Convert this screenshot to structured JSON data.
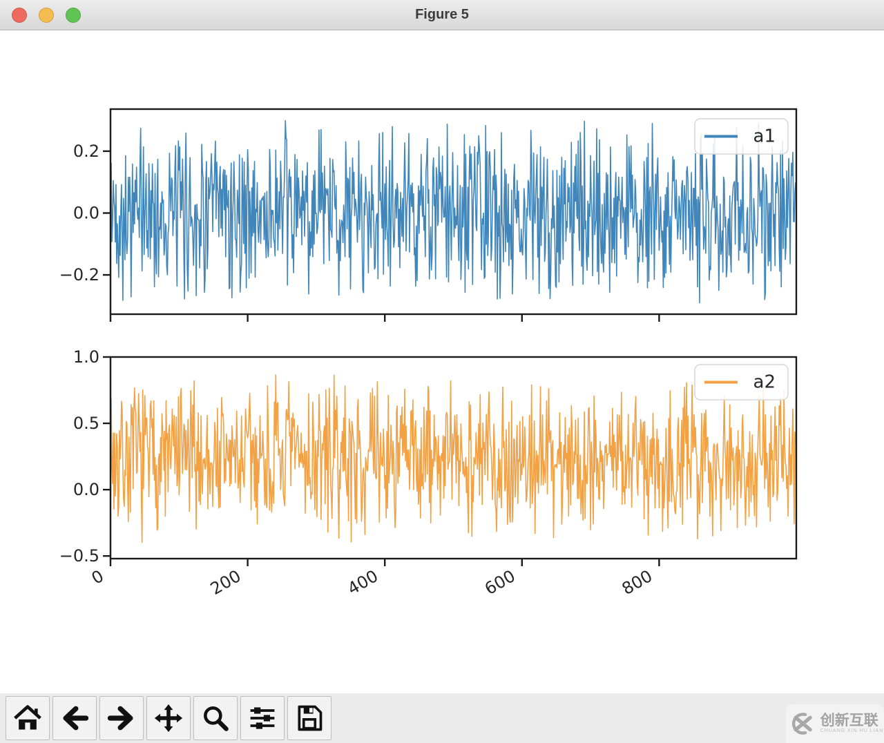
{
  "window": {
    "title": "Figure 5",
    "controls": [
      {
        "name": "close",
        "color": "#ee6a5f"
      },
      {
        "name": "minimize",
        "color": "#f5bd4f"
      },
      {
        "name": "zoom",
        "color": "#61c354"
      }
    ]
  },
  "chart_data": [
    {
      "type": "line",
      "title": "",
      "xlabel": "",
      "ylabel": "",
      "series": [
        {
          "name": "a1",
          "color": "#4186bb",
          "n_points": 1000,
          "seed": 42,
          "mean": 0.0,
          "amplitude": 0.31,
          "distribution": "triangular-noise",
          "observed_min": -0.3,
          "observed_max": 0.31
        }
      ],
      "legend": {
        "entries": [
          "a1"
        ],
        "position": "upper-right"
      },
      "xlim": [
        0,
        1000
      ],
      "ylim": [
        -0.327,
        0.336
      ],
      "xticks": [
        0,
        200,
        400,
        600,
        800
      ],
      "xtick_labels": [],
      "yticks": [
        0.2,
        0.0,
        -0.2
      ],
      "ytick_labels": [
        "0.2",
        "0.0",
        "−0.2"
      ],
      "grid": false
    },
    {
      "type": "line",
      "title": "",
      "xlabel": "",
      "ylabel": "",
      "series": [
        {
          "name": "a2",
          "color": "#f2a245",
          "n_points": 1000,
          "seed": 7,
          "mean": 0.24,
          "amplitude": 0.66,
          "distribution": "triangular-noise",
          "observed_min": -0.47,
          "observed_max": 0.94
        }
      ],
      "legend": {
        "entries": [
          "a2"
        ],
        "position": "upper-right"
      },
      "xlim": [
        0,
        1000
      ],
      "ylim": [
        -0.52,
        1.0
      ],
      "xticks": [
        0,
        200,
        400,
        600,
        800
      ],
      "xtick_labels": [
        "0",
        "200",
        "400",
        "600",
        "800"
      ],
      "xtick_rotation": -30,
      "yticks": [
        1.0,
        0.5,
        0.0,
        -0.5
      ],
      "ytick_labels": [
        "1.0",
        "0.5",
        "0.0",
        "−0.5"
      ],
      "grid": false
    }
  ],
  "toolbar": {
    "buttons": [
      {
        "name": "home",
        "icon": "home-icon"
      },
      {
        "name": "back",
        "icon": "arrow-left-icon"
      },
      {
        "name": "forward",
        "icon": "arrow-right-icon"
      },
      {
        "name": "pan",
        "icon": "move-icon"
      },
      {
        "name": "zoom-to-rect",
        "icon": "magnifier-icon"
      },
      {
        "name": "configure-subplots",
        "icon": "sliders-icon"
      },
      {
        "name": "save",
        "icon": "floppy-icon"
      }
    ]
  },
  "watermark": {
    "brand": "创新互联",
    "subtext": "CHUANG XIN HU LIAN"
  }
}
